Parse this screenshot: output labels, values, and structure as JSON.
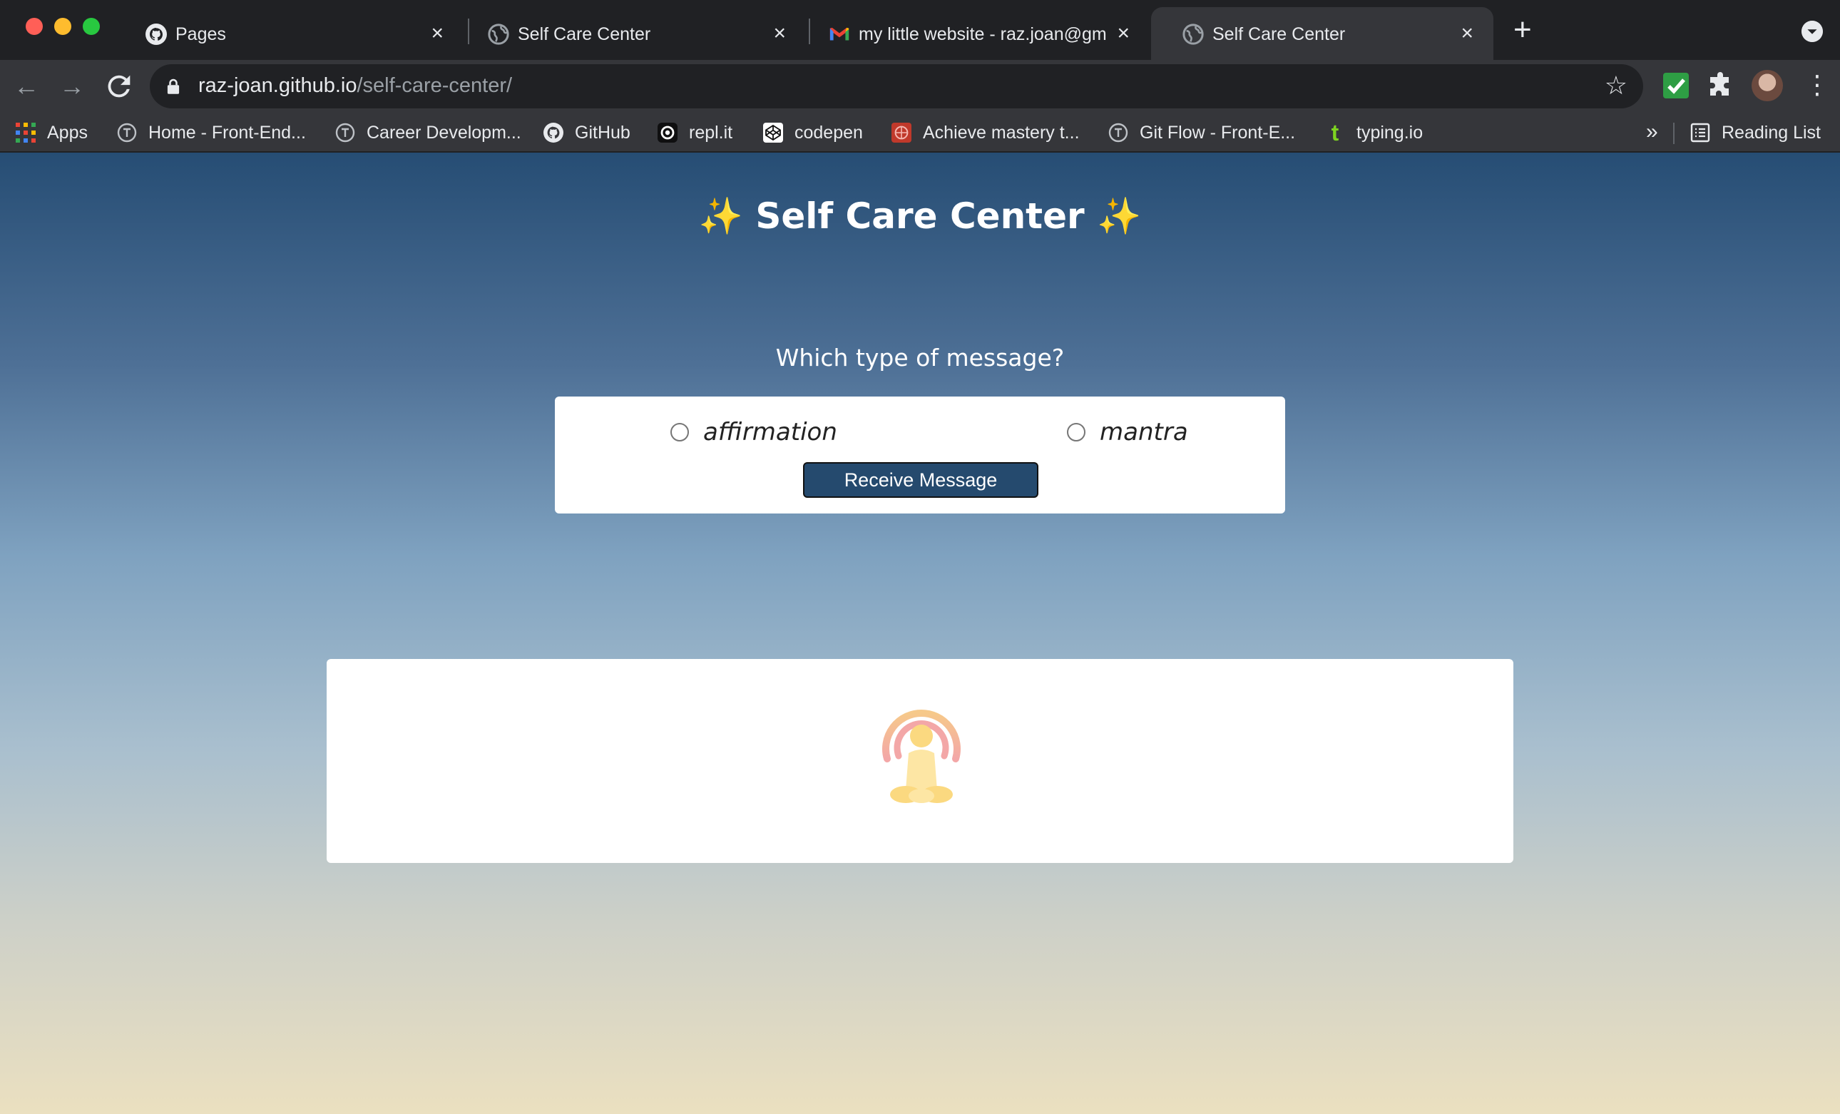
{
  "browser": {
    "tabs": [
      {
        "title": "Pages",
        "icon": "github-icon",
        "active": false
      },
      {
        "title": "Self Care Center",
        "icon": "globe-icon",
        "active": false
      },
      {
        "title": "my little website - raz.joan@gm",
        "icon": "gmail-icon",
        "active": false
      },
      {
        "title": "Self Care Center",
        "icon": "globe-icon",
        "active": true
      }
    ],
    "url_host": "raz-joan.github.io",
    "url_path": "/self-care-center/",
    "bookmarks": [
      {
        "label": "Apps",
        "icon": "apps-grid-icon"
      },
      {
        "label": "Home - Front-End...",
        "icon": "turing-icon"
      },
      {
        "label": "Career Developm...",
        "icon": "turing-icon"
      },
      {
        "label": "GitHub",
        "icon": "github-icon"
      },
      {
        "label": "repl.it",
        "icon": "replit-icon"
      },
      {
        "label": "codepen",
        "icon": "codepen-icon"
      },
      {
        "label": "Achieve mastery t...",
        "icon": "mastery-icon"
      },
      {
        "label": "Git Flow - Front-E...",
        "icon": "turing-icon"
      },
      {
        "label": "typing.io",
        "icon": "typing-icon"
      }
    ],
    "overflow": "»",
    "reading_list": "Reading List"
  },
  "page": {
    "title": "✨ Self Care Center ✨",
    "question": "Which type of message?",
    "options": [
      {
        "label": "affirmation",
        "selected": false
      },
      {
        "label": "mantra",
        "selected": false
      }
    ],
    "button_label": "Receive Message"
  },
  "colors": {
    "button": "#254a6e",
    "gradient_top": "#264d74",
    "gradient_bottom": "#ebe0c0"
  }
}
